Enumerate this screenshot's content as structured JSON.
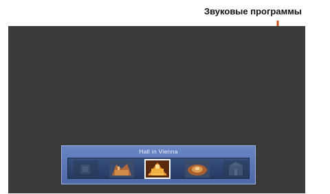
{
  "callout": {
    "label": "Звуковые программы"
  },
  "sound_field": {
    "current_program": "Hall in Vienna",
    "programs": [
      {
        "icon": "venue-dark-icon",
        "selected": false,
        "dimmed": true
      },
      {
        "icon": "venue-hall-icon",
        "selected": false,
        "dimmed": false
      },
      {
        "icon": "hall-in-vienna-icon",
        "selected": true,
        "dimmed": false
      },
      {
        "icon": "venue-theater-icon",
        "selected": false,
        "dimmed": false
      },
      {
        "icon": "venue-church-icon",
        "selected": false,
        "dimmed": true
      }
    ]
  },
  "colors": {
    "callout_line": "#c8501e",
    "screen_bg": "#3a3a38",
    "panel": "#5b76b6"
  }
}
